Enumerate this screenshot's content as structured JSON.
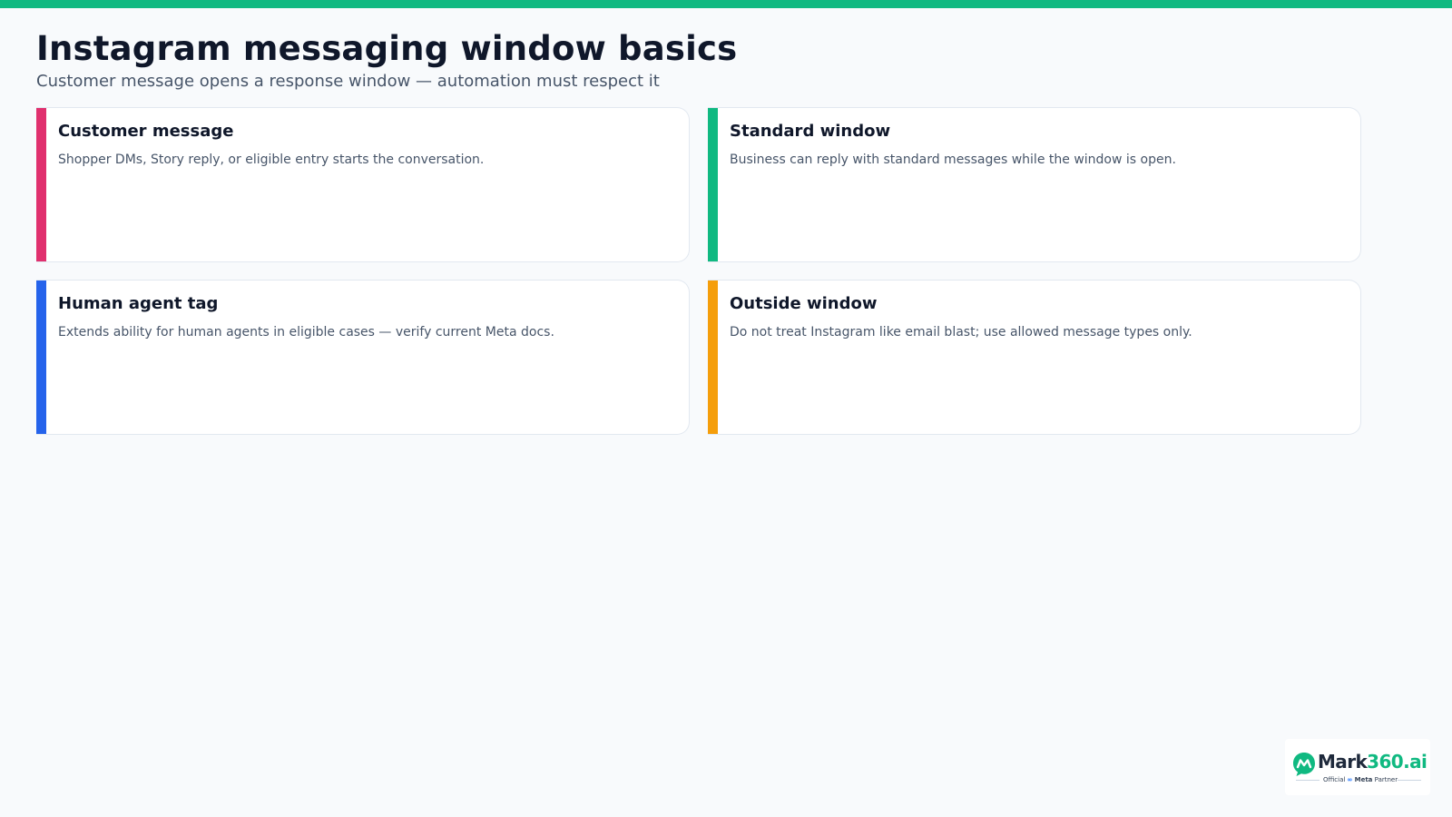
{
  "header": {
    "title": "Instagram messaging window basics",
    "subtitle": "Customer message opens a response window — automation must respect it"
  },
  "cards": [
    {
      "title": "Customer message",
      "body": "Shopper DMs, Story reply, or eligible entry starts the conversation.",
      "accent": "#e0306e"
    },
    {
      "title": "Standard window",
      "body": "Business can reply with standard messages while the window is open.",
      "accent": "#10b981"
    },
    {
      "title": "Human agent tag",
      "body": "Extends ability for human agents in eligible cases — verify current Meta docs.",
      "accent": "#2563eb"
    },
    {
      "title": "Outside window",
      "body": "Do not treat Instagram like email blast; use allowed message types only.",
      "accent": "#f59e0b"
    }
  ],
  "logo": {
    "brand_dark": "Mark",
    "brand_green": "360.ai",
    "sub_official": "Official",
    "sub_meta": "Meta",
    "sub_partner": "Partner",
    "brand_color": "#10b981"
  },
  "colors": {
    "top_bar": "#10b981",
    "background": "#f8fafc"
  }
}
